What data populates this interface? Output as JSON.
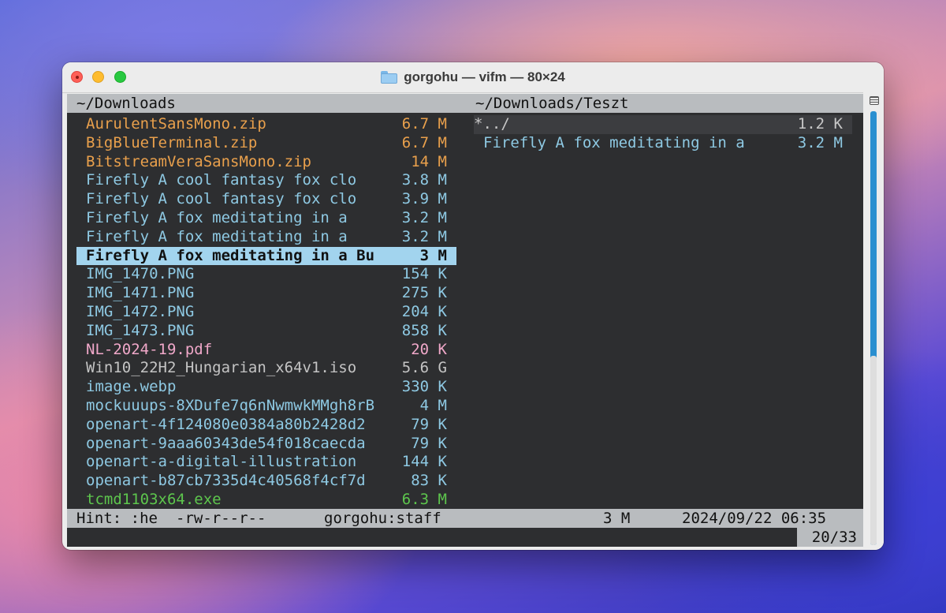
{
  "window": {
    "title": "gorgohu — vifm — 80×24",
    "folder_icon": "folder-icon"
  },
  "left_pane": {
    "path": "~/Downloads",
    "files": [
      {
        "name": "AurulentSansMono.zip",
        "size": "6.7 M",
        "color": "orange"
      },
      {
        "name": "BigBlueTerminal.zip",
        "size": "6.7 M",
        "color": "orange"
      },
      {
        "name": "BitstreamVeraSansMono.zip",
        "size": "14 M",
        "color": "orange"
      },
      {
        "name": "Firefly A cool fantasy fox clo",
        "size": "3.8 M",
        "color": "cyan"
      },
      {
        "name": "Firefly A cool fantasy fox clo",
        "size": "3.9 M",
        "color": "cyan"
      },
      {
        "name": "Firefly A fox meditating in a",
        "size": "3.2 M",
        "color": "cyan"
      },
      {
        "name": "Firefly A fox meditating in a",
        "size": "3.2 M",
        "color": "cyan"
      },
      {
        "name": "Firefly A fox meditating in a Bu",
        "size": "3 M",
        "color": "cyan",
        "selected": true
      },
      {
        "name": "IMG_1470.PNG",
        "size": "154 K",
        "color": "cyan"
      },
      {
        "name": "IMG_1471.PNG",
        "size": "275 K",
        "color": "cyan"
      },
      {
        "name": "IMG_1472.PNG",
        "size": "204 K",
        "color": "cyan"
      },
      {
        "name": "IMG_1473.PNG",
        "size": "858 K",
        "color": "cyan"
      },
      {
        "name": "NL-2024-19.pdf",
        "size": "20 K",
        "color": "pink"
      },
      {
        "name": "Win10_22H2_Hungarian_x64v1.iso",
        "size": "5.6 G",
        "color": "white"
      },
      {
        "name": "image.webp",
        "size": "330 K",
        "color": "cyan"
      },
      {
        "name": "mockuuups-8XDufe7q6nNwmwkMMgh8rB",
        "size": "4 M",
        "color": "cyan"
      },
      {
        "name": "openart-4f124080e0384a80b2428d2",
        "size": "79 K",
        "color": "cyan"
      },
      {
        "name": "openart-9aaa60343de54f018caecda",
        "size": "79 K",
        "color": "cyan"
      },
      {
        "name": "openart-a-digital-illustration",
        "size": "144 K",
        "color": "cyan"
      },
      {
        "name": "openart-b87cb7335d4c40568f4cf7d",
        "size": "83 K",
        "color": "cyan"
      },
      {
        "name": "tcmd1103x64.exe",
        "size": "6.3 M",
        "color": "green"
      }
    ]
  },
  "right_pane": {
    "path": "~/Downloads/Teszt",
    "files": [
      {
        "name": "*../",
        "size": "1.2 K",
        "color": "white",
        "parent": true
      },
      {
        "name": "Firefly A fox meditating in a",
        "size": "3.2 M",
        "color": "cyan"
      }
    ]
  },
  "status": {
    "hint": "Hint: :he",
    "permissions": "-rw-r--r--",
    "owner": "gorgohu:staff",
    "size": "3 M",
    "datetime": "2024/09/22 06:35"
  },
  "command_line": {
    "position": "20/33"
  }
}
